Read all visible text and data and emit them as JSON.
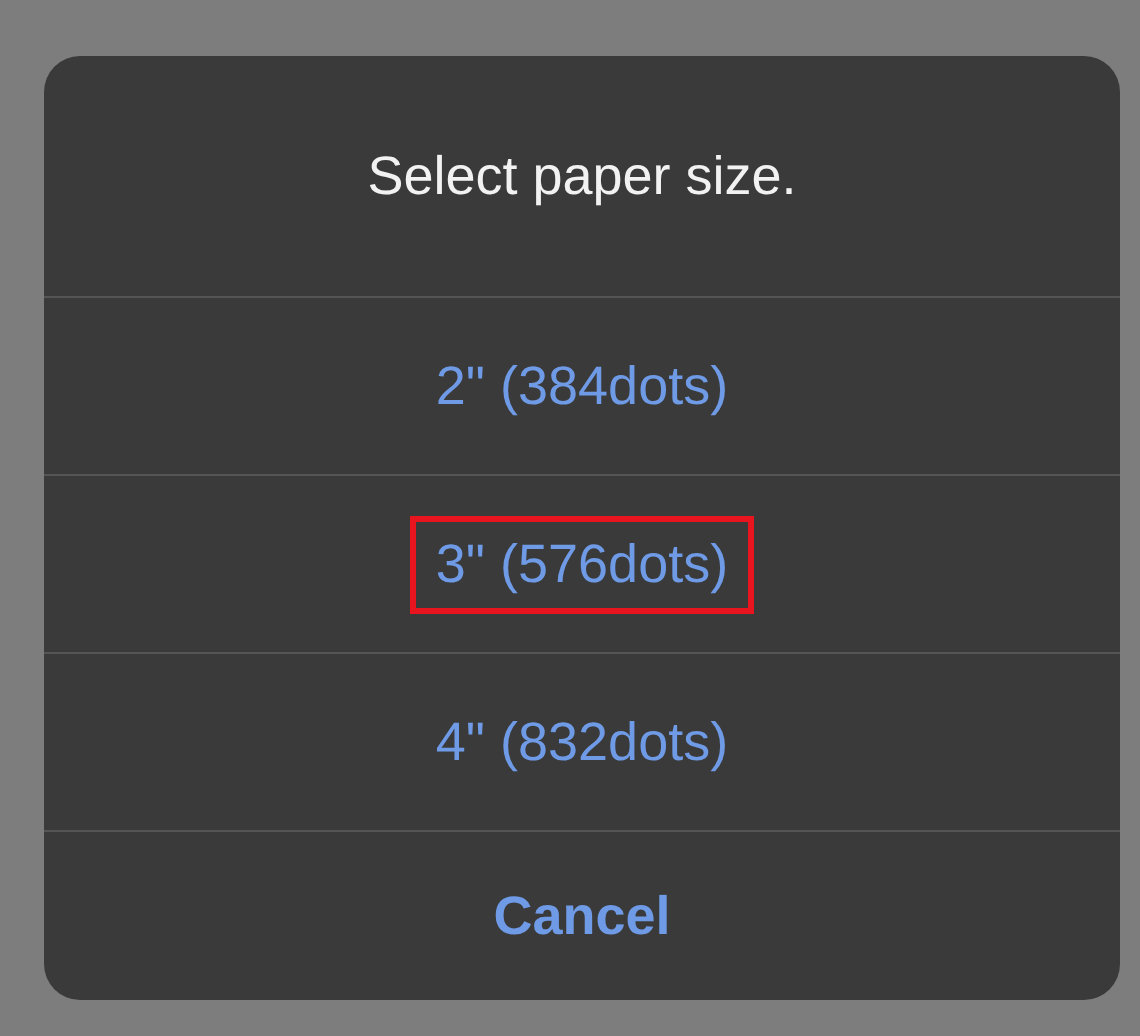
{
  "title": "Select paper size.",
  "options": [
    {
      "label": "2\" (384dots)",
      "highlighted": false
    },
    {
      "label": "3\" (576dots)",
      "highlighted": true
    },
    {
      "label": "4\" (832dots)",
      "highlighted": false
    }
  ],
  "cancel": "Cancel"
}
